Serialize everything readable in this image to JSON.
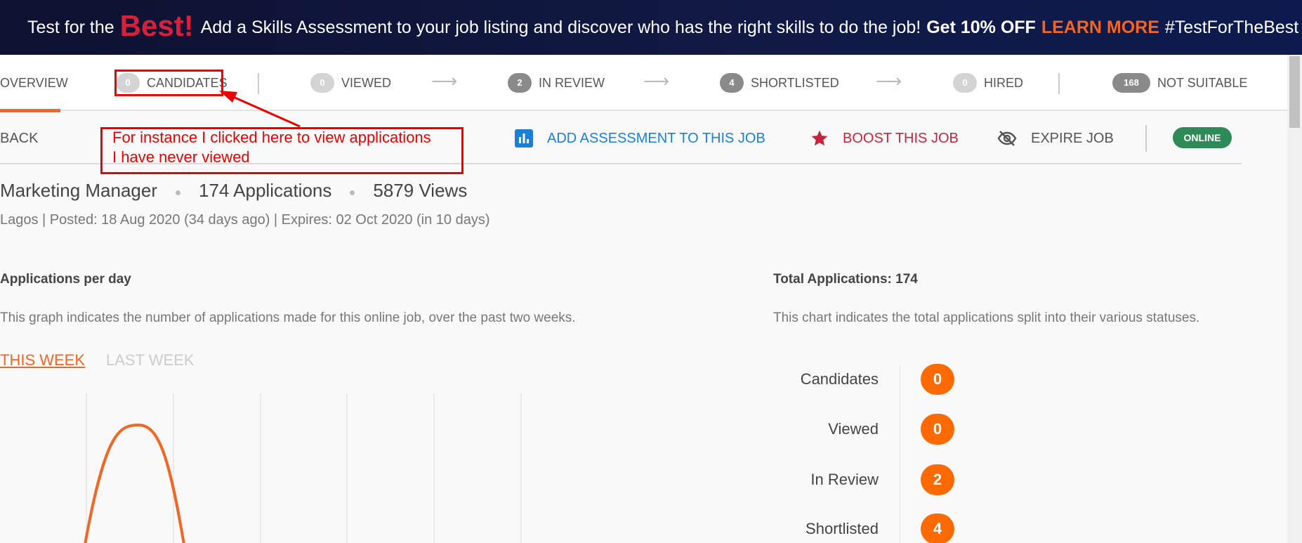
{
  "banner": {
    "prefix": "Test for the",
    "best": "Best!",
    "message": "Add a Skills Assessment to your job listing and discover who has the right skills to do the job!",
    "offer": "Get 10% OFF",
    "learn_more": "LEARN MORE",
    "hashtag": "#TestForTheBest"
  },
  "tabs": {
    "overview": "OVERVIEW",
    "candidates": {
      "count": "0",
      "label": "CANDIDATES"
    },
    "viewed": {
      "count": "0",
      "label": "VIEWED"
    },
    "in_review": {
      "count": "2",
      "label": "IN REVIEW"
    },
    "shortlisted": {
      "count": "4",
      "label": "SHORTLISTED"
    },
    "hired": {
      "count": "0",
      "label": "HIRED"
    },
    "not_suitable": {
      "count": "168",
      "label": "NOT SUITABLE"
    },
    "arrow": "⟶"
  },
  "actions": {
    "back": "BACK",
    "add_assessment": "ADD ASSESSMENT TO THIS JOB",
    "boost": "BOOST THIS JOB",
    "expire": "EXPIRE JOB",
    "status": "ONLINE"
  },
  "job": {
    "title": "Marketing Manager",
    "applications": "174 Applications",
    "views": "5879 Views",
    "meta": "Lagos | Posted: 18 Aug 2020 (34 days ago) | Expires: 02 Oct 2020 (in 10 days)"
  },
  "applications_per_day": {
    "heading": "Applications per day",
    "description": "This graph indicates the number of applications made for this online job, over the past two weeks.",
    "this_week": "THIS WEEK",
    "last_week": "LAST WEEK"
  },
  "total": {
    "heading": "Total Applications: 174",
    "description": "This chart indicates the total applications split into their various statuses.",
    "statuses": [
      {
        "label": "Candidates",
        "count": "0"
      },
      {
        "label": "Viewed",
        "count": "0"
      },
      {
        "label": "In Review",
        "count": "2"
      },
      {
        "label": "Shortlisted",
        "count": "4"
      }
    ]
  },
  "annotation": {
    "line1": "For instance I clicked here to view applications",
    "line2": "I have never viewed"
  },
  "colors": {
    "accent": "#f26522",
    "banner_bg": "#0e1130",
    "best": "#d8203c",
    "assessment_blue": "#1a7fd6",
    "boost_red": "#c8233b",
    "online_green": "#2e8b57",
    "annotation_red": "#ee0000",
    "badge_orange": "#ff6a00"
  }
}
